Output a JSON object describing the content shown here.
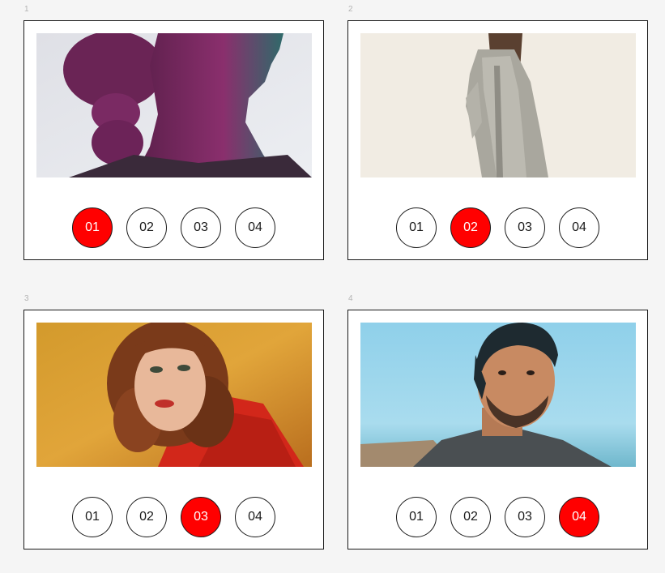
{
  "colors": {
    "active": "#ff0000",
    "border": "#1a1a1a",
    "background": "#f5f5f5",
    "label": "#b3b3b3"
  },
  "frames": [
    {
      "label": "1",
      "image": "woman-profile-purple-tint-photo",
      "active_index": 0,
      "buttons": [
        "01",
        "02",
        "03",
        "04"
      ]
    },
    {
      "label": "2",
      "image": "woman-in-grey-coat-photo",
      "active_index": 1,
      "buttons": [
        "01",
        "02",
        "03",
        "04"
      ]
    },
    {
      "label": "3",
      "image": "curly-haired-woman-red-sweater-photo",
      "active_index": 2,
      "buttons": [
        "01",
        "02",
        "03",
        "04"
      ]
    },
    {
      "label": "4",
      "image": "smiling-man-backwards-cap-photo",
      "active_index": 3,
      "buttons": [
        "01",
        "02",
        "03",
        "04"
      ]
    }
  ]
}
